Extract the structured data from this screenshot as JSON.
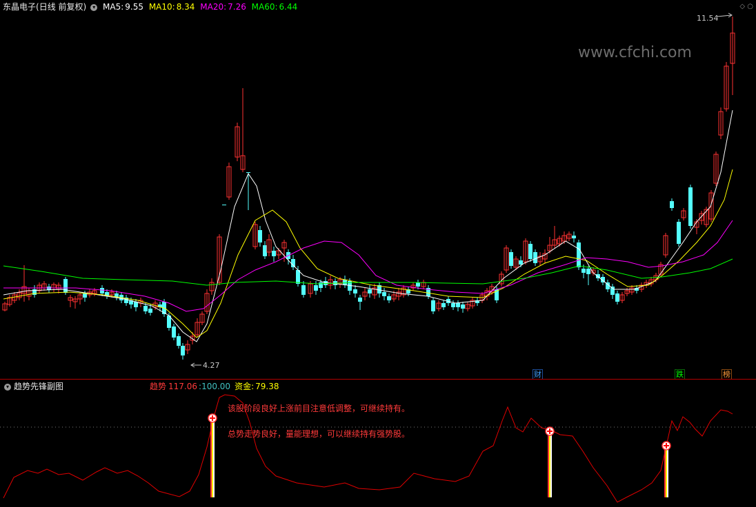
{
  "main_panel": {
    "stock_name": "东晶电子",
    "period": "(日线 前复权)",
    "ma": [
      {
        "label": "MA5:",
        "value": "9.55",
        "color": "#ffffff"
      },
      {
        "label": "MA10:",
        "value": "8.34",
        "color": "#ffff00"
      },
      {
        "label": "MA20:",
        "value": "7.26",
        "color": "#ff00ff"
      },
      {
        "label": "MA60:",
        "value": "6.44",
        "color": "#00ff00"
      }
    ],
    "high_label": "11.54",
    "low_label": "4.27",
    "watermark": "www.cfchi.com",
    "event_tags": [
      {
        "text": "财",
        "color": "#3fa0ff"
      },
      {
        "text": "跌",
        "color": "#00ff00"
      },
      {
        "text": "榜",
        "color": "#ff9a3a"
      }
    ]
  },
  "sub_panel": {
    "title": "趋势先锋副图",
    "trend_label": "趋势",
    "trend_value": "117.06",
    "level_value": "100.00",
    "fund_label": "资金:",
    "fund_value": "79.38",
    "message_1": "该股阶段良好上涨前目注意低调整，可继续持有。",
    "message_2": "总势走势良好，量能理想，可以继续持有强势股。"
  },
  "colors": {
    "rise": "#ff3232",
    "fall": "#54ffff",
    "ma5": "#ffffff",
    "ma10": "#ffff00",
    "ma20": "#ff00ff",
    "ma60": "#00ff00",
    "trend_line": "#e00000"
  }
}
